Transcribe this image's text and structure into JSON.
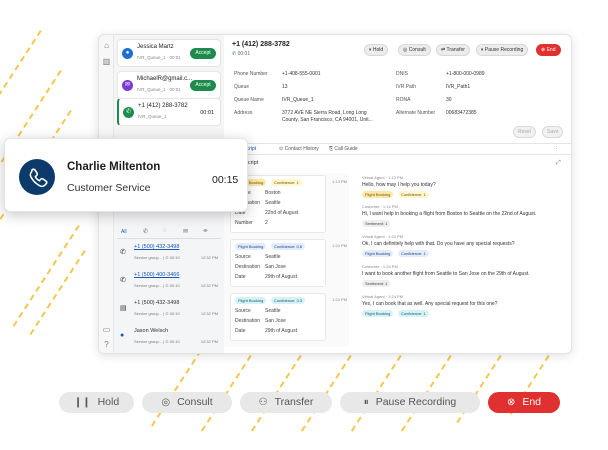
{
  "app": {
    "tasks": [
      {
        "name": "Jessica Martz",
        "sub": "IVR_Queue_1 · 00:01",
        "action": "Accept",
        "color": "#1f6fd0"
      },
      {
        "name": "MichaelR@gmail.c...",
        "sub": "IVR_Queue_1 · 00:01",
        "action": "Accept",
        "color": "#7b3ad0"
      },
      {
        "name": "+1 (412) 288-3782",
        "sub": "IVR_Queue_1",
        "action": "00:01",
        "color": "#1d8b4e"
      }
    ],
    "header": {
      "number": "+1 (412) 288-3782",
      "timer": "00:01"
    },
    "controls": [
      "Hold",
      "Consult",
      "Transfer",
      "Pause Recording",
      "End"
    ],
    "details_left": [
      {
        "label": "Phone Number",
        "value": "+1-408-555-0001"
      },
      {
        "label": "Queue",
        "value": "13"
      },
      {
        "label": "Queue Name",
        "value": "IVR_Queue_1"
      },
      {
        "label": "Address",
        "value": "3772 AVE NE Sierra Road, Long Long County, San Francisco, CA 94001, Unit..."
      }
    ],
    "details_right": [
      {
        "label": "DNIS",
        "value": "+1-800-000-0989"
      },
      {
        "label": "IVR Path",
        "value": "IVR_Path1"
      },
      {
        "label": "RONA",
        "value": "30"
      },
      {
        "label": "Alternate Number",
        "value": "00683472385"
      }
    ],
    "detail_buttons": [
      "Reset",
      "Save"
    ],
    "tabs": [
      "Transcript",
      "Contact History",
      "Call Guide"
    ],
    "subtitle": "Transcript",
    "history_tabs": [
      "All"
    ],
    "history": [
      {
        "number": "+1 (500) 432-3498",
        "desc": "Service group...",
        "dur": "00:10",
        "time": "12:32 PM"
      },
      {
        "number": "+1 (500) 400-3466",
        "desc": "Service group...",
        "dur": "00:10",
        "time": "12:32 PM"
      },
      {
        "number": "+1 (500) 432-3498",
        "desc": "Service group...",
        "dur": "00:10",
        "time": "12:32 PM"
      },
      {
        "number": "Jason Welsch",
        "desc": "Service group...",
        "dur": "00:10",
        "time": "12:32 PM"
      }
    ],
    "intent_cards": [
      {
        "intent": "Flight Booking",
        "conf": "Confidence: 1",
        "time": "1:13 PM",
        "rows": [
          [
            "Source",
            "Boston"
          ],
          [
            "Destination",
            "Seattle"
          ],
          [
            "Date",
            "22nd of August"
          ],
          [
            "Number",
            "2"
          ]
        ]
      },
      {
        "intent": "Flight Booking",
        "conf": "Confidence: 0.8",
        "time": "1:24 PM",
        "rows": [
          [
            "Source",
            "Seattle"
          ],
          [
            "Destination",
            "San Jose"
          ],
          [
            "Date",
            "29th of August"
          ]
        ]
      },
      {
        "intent": "Flight Booking",
        "conf": "Confidence: 3.3",
        "time": "1:24 PM",
        "rows": [
          [
            "Source",
            "Seattle"
          ],
          [
            "Destination",
            "San Jose"
          ],
          [
            "Date",
            "29th of August"
          ]
        ]
      }
    ],
    "chat": [
      {
        "who": "Virtual Agent · 1:13 PM",
        "text": "Hello, how may I help you today?",
        "tags": [
          "Flight Booking",
          "Confidence: 1"
        ]
      },
      {
        "who": "Customer · 1:14 PM",
        "text": "Hi, I want help in booking a flight from Boston to Seattle on the 22nd of August.",
        "tags": [
          "Sentiment: 1"
        ]
      },
      {
        "who": "Virtual Agent · 1:24 PM",
        "text": "Ok, I can definitely help with that. Do you have any special requests?",
        "tags": [
          "Flight Booking",
          "Confidence: 1"
        ]
      },
      {
        "who": "Customer · 1:24 PM",
        "text": "I want to book another flight from Seattle to San Jose on the 29th of August.",
        "tags": [
          "Sentiment: 1"
        ]
      },
      {
        "who": "Virtual Agent · 1:24 PM",
        "text": "Yes, I can book that as well. Any special request for this one?",
        "tags": [
          "Flight Booking",
          "Confidence: 1"
        ]
      }
    ]
  },
  "popup": {
    "name": "Charlie Miltenton",
    "role": "Customer Service",
    "timer": "00:15"
  },
  "bottom_bar": [
    "Hold",
    "Consult",
    "Transfer",
    "Pause Recording",
    "End"
  ],
  "colors": {
    "accent": "#1d8b4e",
    "end": "#e0302f",
    "navy": "#0c3a6b",
    "dash": "#f3c13a"
  }
}
